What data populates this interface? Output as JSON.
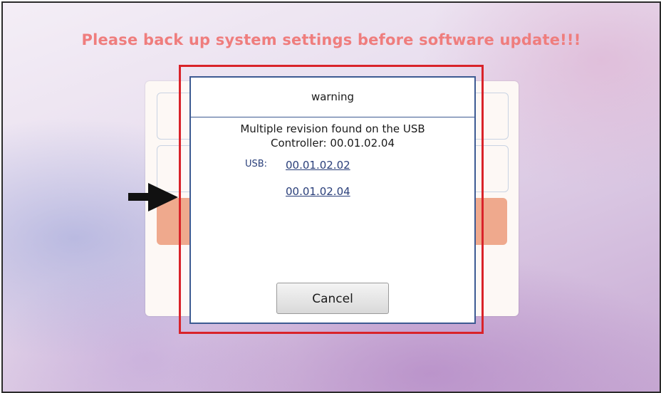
{
  "headline": "Please back up system settings before software update!!!",
  "dialog": {
    "title": "warning",
    "message_line1": "Multiple revision found on the USB",
    "message_line2": "Controller: 00.01.02.04",
    "usb_label": "USB:",
    "revisions": [
      "00.01.02.02",
      "00.01.02.04"
    ],
    "cancel_label": "Cancel"
  },
  "colors": {
    "headline": "#ef7d7d",
    "dialog_border": "#3d5a92",
    "highlight": "#d9232a",
    "link": "#2a3f7a",
    "panel_accent_row": "#efa98d"
  },
  "icons": {
    "pointer": "arrow-right-icon"
  }
}
